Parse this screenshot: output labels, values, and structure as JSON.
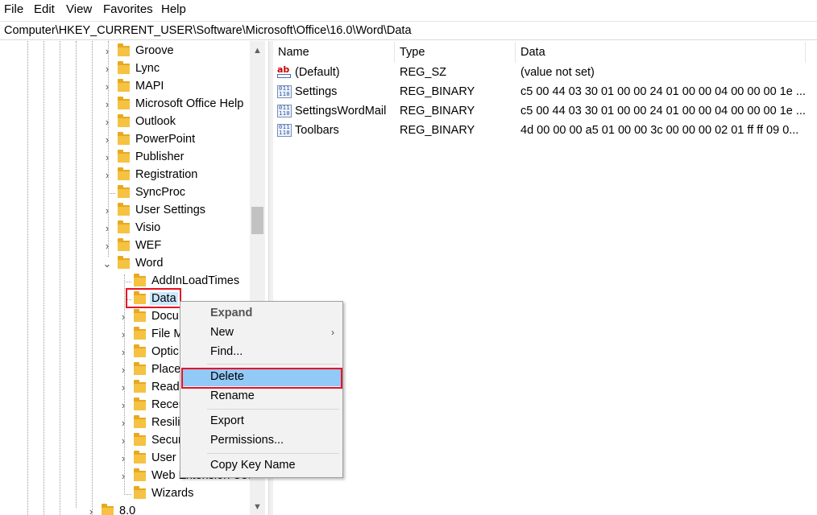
{
  "menubar": {
    "items": [
      "File",
      "Edit",
      "View",
      "Favorites",
      "Help"
    ]
  },
  "address": {
    "path": "Computer\\HKEY_CURRENT_USER\\Software\\Microsoft\\Office\\16.0\\Word\\Data"
  },
  "tree": {
    "level1": [
      "Groove",
      "Lync",
      "MAPI",
      "Microsoft Office Help",
      "Outlook",
      "PowerPoint",
      "Publisher",
      "Registration",
      "SyncProc",
      "User Settings",
      "Visio",
      "WEF",
      "Word"
    ],
    "level2": [
      "AddInLoadTimes",
      "Data",
      "Docu",
      "File M",
      "Optic",
      "Place",
      "Read",
      "Recer",
      "Resili",
      "Secur",
      "User I",
      "Web Extension Use",
      "Wizards"
    ],
    "bottom": "8.0",
    "expanders": {
      "collapsed": "›",
      "expanded": "⌄"
    }
  },
  "list": {
    "headers": {
      "name": "Name",
      "type": "Type",
      "data": "Data"
    },
    "rows": [
      {
        "icon": "string-value-icon",
        "name": "(Default)",
        "type": "REG_SZ",
        "data": "(value not set)"
      },
      {
        "icon": "binary-value-icon",
        "name": "Settings",
        "type": "REG_BINARY",
        "data": "c5 00 44 03 30 01 00 00 24 01 00 00 04 00 00 00 1e ..."
      },
      {
        "icon": "binary-value-icon",
        "name": "SettingsWordMail",
        "type": "REG_BINARY",
        "data": "c5 00 44 03 30 01 00 00 24 01 00 00 04 00 00 00 1e ..."
      },
      {
        "icon": "binary-value-icon",
        "name": "Toolbars",
        "type": "REG_BINARY",
        "data": "4d 00 00 00 a5 01 00 00 3c 00 00 00 02 01 ff ff 09 0..."
      }
    ]
  },
  "context_menu": {
    "expand": "Expand",
    "new": "New",
    "new_arrow": "›",
    "find": "Find...",
    "delete": "Delete",
    "rename": "Rename",
    "export": "Export",
    "permissions": "Permissions...",
    "copy_key_name": "Copy Key Name"
  },
  "icons": {
    "ab": "ab",
    "bin": "011\n110",
    "scroll_up": "▲",
    "scroll_down": "▼"
  },
  "colors": {
    "highlight_red": "#e81123",
    "menu_selected": "#91c9f7",
    "folder": "#f5c242"
  }
}
